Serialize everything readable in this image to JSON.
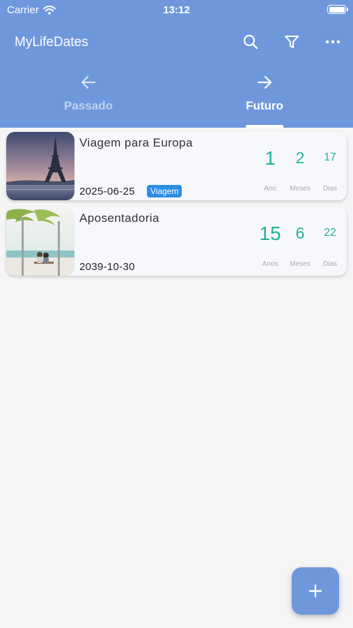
{
  "status_bar": {
    "carrier": "Carrier",
    "time": "13:12"
  },
  "app_bar": {
    "title": "MyLifeDates",
    "icons": [
      "search-icon",
      "filter-icon",
      "more-icon"
    ]
  },
  "tabs": [
    {
      "label": "Passado",
      "icon": "arrow-left-icon",
      "selected": false
    },
    {
      "label": "Futuro",
      "icon": "arrow-right-icon",
      "selected": true
    }
  ],
  "events": [
    {
      "title": "Viagem para Europa",
      "date": "2025-06-25",
      "tag": "Viagem",
      "countdown": [
        {
          "value": "1",
          "unit": "Ano"
        },
        {
          "value": "2",
          "unit": "Meses"
        },
        {
          "value": "17",
          "unit": "Dias"
        }
      ]
    },
    {
      "title": "Aposentadoria",
      "date": "2039-10-30",
      "countdown": [
        {
          "value": "15",
          "unit": "Anos"
        },
        {
          "value": "6",
          "unit": "Meses"
        },
        {
          "value": "22",
          "unit": "Dias"
        }
      ]
    }
  ],
  "fab": {
    "icon": "plus-icon"
  },
  "colors": {
    "primary": "#6f98dc",
    "accent": "#22b39a",
    "badge": "#2b8de4",
    "background": "#f5f5f5"
  }
}
